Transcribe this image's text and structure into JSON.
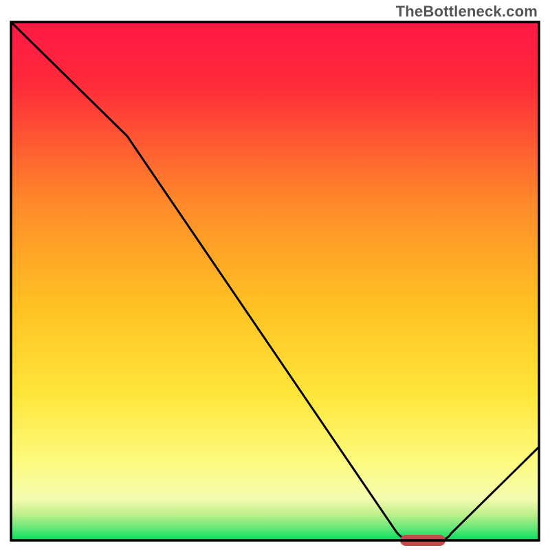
{
  "watermark": {
    "text": "TheBottleneck.com"
  },
  "chart_data": {
    "type": "line",
    "title": "",
    "xlabel": "",
    "ylabel": "",
    "xlim": [
      0,
      100
    ],
    "ylim": [
      0,
      100
    ],
    "x": [
      0,
      22,
      74,
      82,
      100
    ],
    "values": [
      100,
      78,
      0,
      0,
      18
    ],
    "colors": {
      "gradient_top": "#ff1844",
      "gradient_mid_orange": "#ff9a2a",
      "gradient_mid_yellow": "#ffe63a",
      "gradient_light_yellow": "#fdfda0",
      "gradient_bottom": "#00e060",
      "curve": "#000000",
      "marker": "#c14b4b"
    },
    "marker": {
      "x_start": 74,
      "x_end": 82,
      "y": 0
    }
  }
}
